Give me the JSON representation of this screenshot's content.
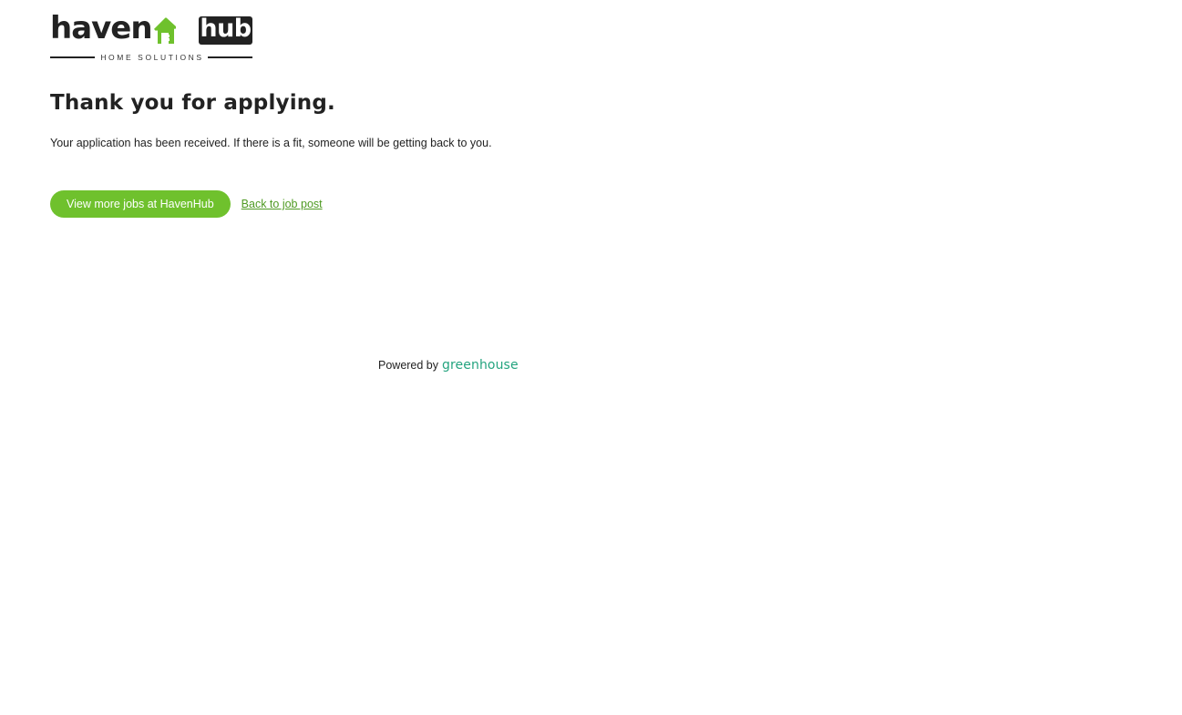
{
  "logo": {
    "word_left": "haven",
    "word_right": "hub",
    "tagline": "HOME SOLUTIONS",
    "colors": {
      "dark": "#222222",
      "accent": "#6fc12d"
    }
  },
  "confirmation": {
    "title": "Thank you for applying.",
    "message": "Your application has been received. If there is a fit, someone will be getting back to you."
  },
  "actions": {
    "view_jobs_label": "View more jobs at HavenHub",
    "back_label": "Back to job post"
  },
  "footer": {
    "powered_by": "Powered by",
    "brand": "greenhouse"
  },
  "colors": {
    "button": "#6fc12d",
    "link": "#4f9a23",
    "greenhouse": "#24a47f"
  }
}
